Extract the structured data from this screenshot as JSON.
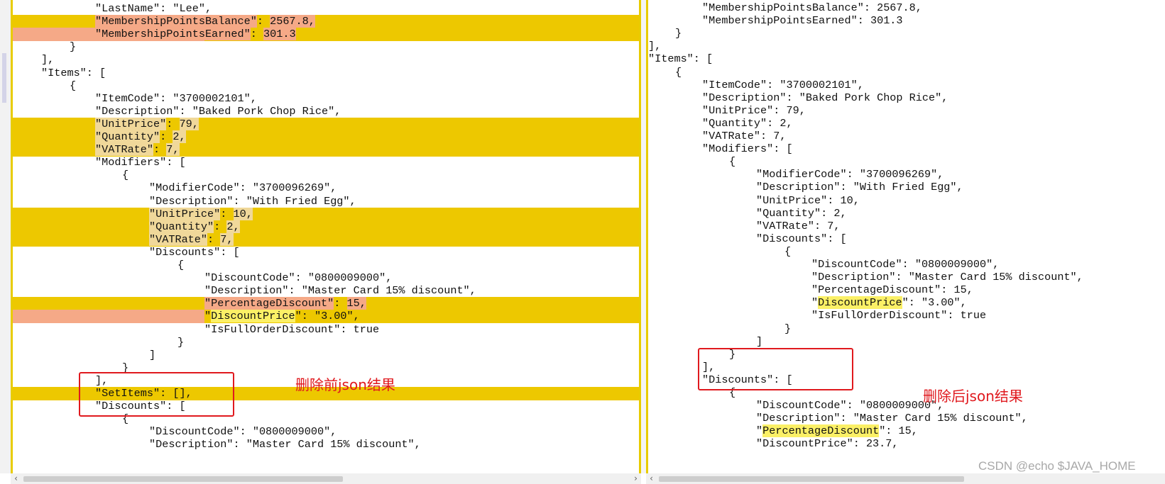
{
  "left_pane": {
    "lines": [
      "\"LastName\": \"Lee\",",
      "\"MembershipPointsBalance\": 2567.8,",
      "\"MembershipPointsEarned\": 301.3",
      "}",
      "],",
      "\"Items\": [",
      "{",
      "\"ItemCode\": \"3700002101\",",
      "\"Description\": \"Baked Pork Chop Rice\",",
      "\"UnitPrice\": 79,",
      "\"Quantity\": 2,",
      "\"VATRate\": 7,",
      "\"Modifiers\": [",
      "{",
      "\"ModifierCode\": \"3700096269\",",
      "\"Description\": \"With Fried Egg\",",
      "\"UnitPrice\": 10,",
      "\"Quantity\": 2,",
      "\"VATRate\": 7,",
      "\"Discounts\": [",
      "{",
      "\"DiscountCode\": \"0800009000\",",
      "\"Description\": \"Master Card 15% discount\",",
      "\"PercentageDiscount\": 15,",
      "\"DiscountPrice\": \"3.00\",",
      "\"IsFullOrderDiscount\": true",
      "}",
      "]",
      "}",
      "],",
      "\"SetItems\": [],",
      "\"Discounts\": [",
      "{",
      "\"DiscountCode\": \"0800009000\",",
      "\"Description\": \"Master Card 15% discount\","
    ]
  },
  "right_pane": {
    "lines": [
      "\"MembershipPointsBalance\": 2567.8,",
      "\"MembershipPointsEarned\": 301.3",
      "}",
      "],",
      "\"Items\": [",
      "{",
      "\"ItemCode\": \"3700002101\",",
      "\"Description\": \"Baked Pork Chop Rice\",",
      "\"UnitPrice\": 79,",
      "\"Quantity\": 2,",
      "\"VATRate\": 7,",
      "\"Modifiers\": [",
      "{",
      "\"ModifierCode\": \"3700096269\",",
      "\"Description\": \"With Fried Egg\",",
      "\"UnitPrice\": 10,",
      "\"Quantity\": 2,",
      "\"VATRate\": 7,",
      "\"Discounts\": [",
      "{",
      "\"DiscountCode\": \"0800009000\",",
      "\"Description\": \"Master Card 15% discount\",",
      "\"PercentageDiscount\": 15,",
      "\"DiscountPrice\": \"3.00\",",
      "\"IsFullOrderDiscount\": true",
      "}",
      "]",
      "}",
      "],",
      "\"Discounts\": [",
      "{",
      "\"DiscountCode\": \"0800009000\",",
      "\"Description\": \"Master Card 15% discount\",",
      "\"PercentageDiscount\": 15,",
      "\"DiscountPrice\": 23.7,"
    ]
  },
  "annotations": {
    "before_label": "删除前json结果",
    "after_label": "删除后json结果"
  },
  "scrollbars": {
    "left_arrow": "‹",
    "right_arrow": "›"
  },
  "watermark": "CSDN @echo $JAVA_HOME",
  "colors": {
    "diff_highlight": "#edc800",
    "diff_salmon": "#f5a987",
    "annotation_red": "#e0191e",
    "pane_border": "#e8cc00"
  }
}
